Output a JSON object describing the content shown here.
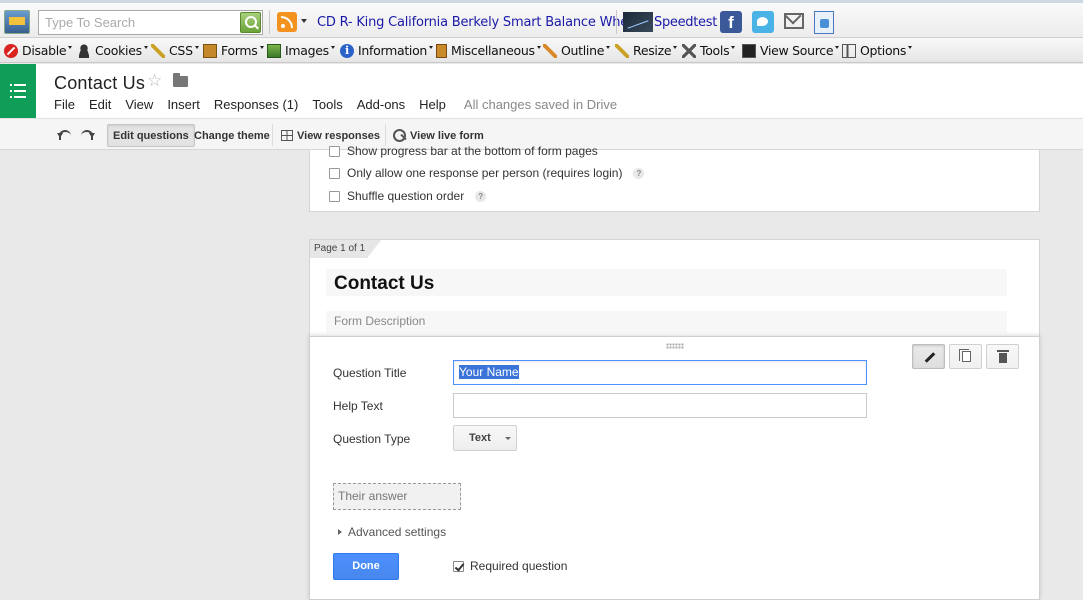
{
  "browser_toolbar": {
    "search_placeholder": "Type To Search",
    "feed_link": "CD R- King California Berkely Smart Balance Wheel...",
    "speedtest_link": "Speedtest",
    "facebook_letter": "f"
  },
  "webdev_toolbar": {
    "items": [
      {
        "label": "Disable",
        "icon": "disable-icon"
      },
      {
        "label": "Cookies",
        "icon": "cookies-icon"
      },
      {
        "label": "CSS",
        "icon": "css-icon"
      },
      {
        "label": "Forms",
        "icon": "forms-icon"
      },
      {
        "label": "Images",
        "icon": "images-icon"
      },
      {
        "label": "Information",
        "icon": "information-icon"
      },
      {
        "label": "Miscellaneous",
        "icon": "miscellaneous-icon"
      },
      {
        "label": "Outline",
        "icon": "outline-icon"
      },
      {
        "label": "Resize",
        "icon": "resize-icon"
      },
      {
        "label": "Tools",
        "icon": "tools-icon"
      },
      {
        "label": "View Source",
        "icon": "view-source-icon"
      },
      {
        "label": "Options",
        "icon": "options-icon"
      }
    ]
  },
  "doc": {
    "title": "Contact  Us",
    "menu": [
      "File",
      "Edit",
      "View",
      "Insert",
      "Responses (1)",
      "Tools",
      "Add-ons",
      "Help"
    ],
    "save_status": "All changes saved in Drive"
  },
  "toolbar": {
    "edit_questions": "Edit questions",
    "change_theme": "Change theme",
    "view_responses": "View responses",
    "view_live_form": "View live form"
  },
  "settings": {
    "show_progress": "Show progress bar at the bottom of form pages",
    "one_response": "Only allow one response per person (requires login)",
    "shuffle": "Shuffle question order",
    "help_mark": "?"
  },
  "form": {
    "page_label": "Page 1 of 1",
    "title": "Contact  Us",
    "description_placeholder": "Form Description"
  },
  "question": {
    "title_label": "Question Title",
    "title_value": "Your Name",
    "help_label": "Help Text",
    "help_value": "",
    "type_label": "Question Type",
    "type_value": "Text",
    "answer_preview": "Their answer",
    "advanced": "Advanced settings",
    "done": "Done",
    "required_label": "Required question",
    "required_checked": true
  },
  "colors": {
    "forms_green": "#0f9d58",
    "done_blue": "#4d90fe",
    "link_blue": "#1a1aa8"
  }
}
